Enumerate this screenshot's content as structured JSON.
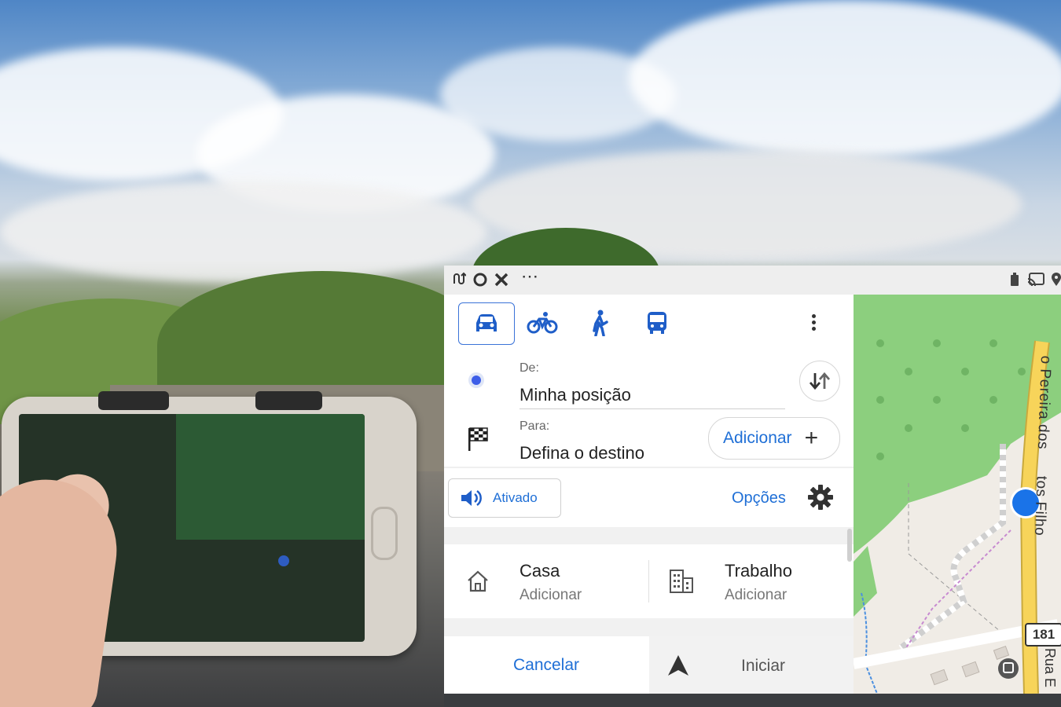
{
  "window": {
    "controls": [
      "route-icon",
      "circle-icon",
      "close-icon",
      "more-horizontal-icon"
    ]
  },
  "status_icons": [
    "battery-icon",
    "cast-icon",
    "location-icon"
  ],
  "modes": [
    {
      "name": "car",
      "active": true
    },
    {
      "name": "bicycle",
      "active": false
    },
    {
      "name": "walk",
      "active": false
    },
    {
      "name": "bus",
      "active": false
    }
  ],
  "route": {
    "from_label": "De:",
    "from_value": "Minha posição",
    "to_label": "Para:",
    "to_value": "Defina o destino",
    "add_label": "Adicionar",
    "add_symbol": "+"
  },
  "sound": {
    "label": "Ativado"
  },
  "options": {
    "label": "Opções"
  },
  "favorites": {
    "home_title": "Casa",
    "home_sub": "Adicionar",
    "work_title": "Trabalho",
    "work_sub": "Adicionar"
  },
  "actions": {
    "cancel": "Cancelar",
    "start": "Iniciar"
  },
  "map": {
    "street_name": "Pereira dos Santos Filho",
    "street_name_visible_top": "o Pereira dos ",
    "street_name_visible_bottom": "tos Filho",
    "road_badge": "181",
    "street_bottom": "Rua E"
  },
  "colors": {
    "accent": "#1f6fd6",
    "location_dot": "#1a73e8",
    "map_green": "#8ccf7e",
    "road_yellow": "#f7d45a"
  }
}
